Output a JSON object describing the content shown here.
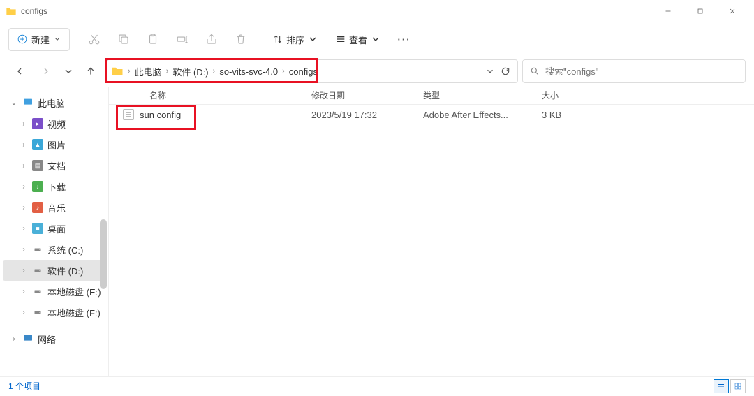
{
  "window": {
    "title": "configs"
  },
  "toolbar": {
    "new_label": "新建",
    "sort_label": "排序",
    "view_label": "查看"
  },
  "breadcrumb": {
    "items": [
      "此电脑",
      "软件 (D:)",
      "so-vits-svc-4.0",
      "configs"
    ]
  },
  "search": {
    "placeholder": "搜索\"configs\""
  },
  "sidebar": {
    "pc": "此电脑",
    "items": [
      {
        "label": "视频",
        "icon": "clip"
      },
      {
        "label": "图片",
        "icon": "image"
      },
      {
        "label": "文档",
        "icon": "doc"
      },
      {
        "label": "下载",
        "icon": "down"
      },
      {
        "label": "音乐",
        "icon": "music"
      },
      {
        "label": "桌面",
        "icon": "desk"
      },
      {
        "label": "系统 (C:)",
        "icon": "drive"
      },
      {
        "label": "软件 (D:)",
        "icon": "drive",
        "selected": true
      },
      {
        "label": "本地磁盘 (E:)",
        "icon": "drive"
      },
      {
        "label": "本地磁盘 (F:)",
        "icon": "drive"
      }
    ],
    "network": "网络"
  },
  "columns": {
    "name": "名称",
    "date": "修改日期",
    "type": "类型",
    "size": "大小"
  },
  "files": [
    {
      "name": "sun config",
      "date": "2023/5/19 17:32",
      "type": "Adobe After Effects...",
      "size": "3 KB"
    }
  ],
  "status": {
    "count": "1 个项目"
  }
}
